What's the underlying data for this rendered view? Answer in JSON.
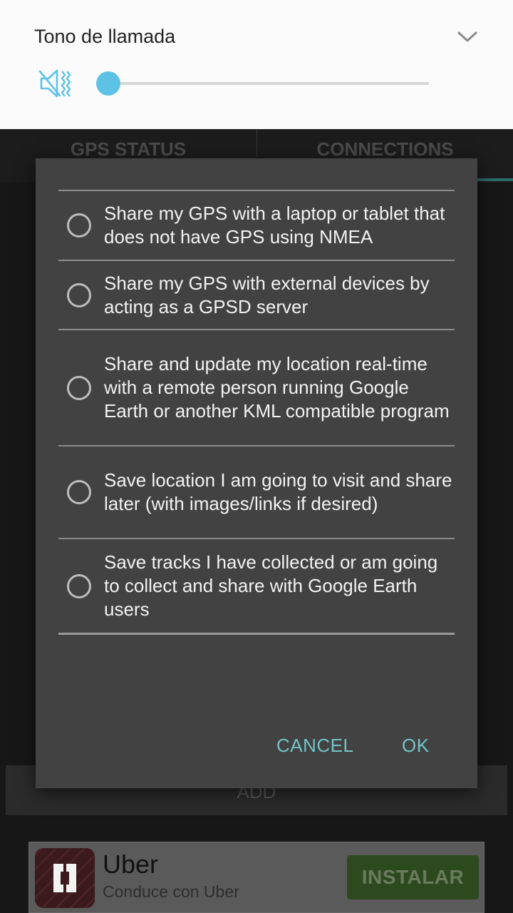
{
  "volume": {
    "title": "Tono de llamada",
    "level": 0,
    "icon": "speaker-muted-vibrate-icon",
    "accent": "#5ec2e6"
  },
  "app": {
    "tabs": [
      {
        "label": "GPS STATUS"
      },
      {
        "label": "CONNECTIONS",
        "selected": true
      }
    ],
    "add_label": "ADD"
  },
  "dialog": {
    "options": [
      {
        "text": "Share my GPS with a laptop or tablet that does not have GPS using NMEA",
        "checked": false
      },
      {
        "text": "Share my GPS with external devices by acting as a GPSD server",
        "checked": false
      },
      {
        "text": "Share and update my location real-time with a remote person running Google Earth or another KML compatible program",
        "checked": false
      },
      {
        "text": "Save location I am going to visit and share later (with images/links if desired)",
        "checked": false
      },
      {
        "text": "Save tracks I have collected or am going to collect and share with Google Earth users",
        "checked": false
      }
    ],
    "cancel_label": "CANCEL",
    "ok_label": "OK",
    "accent": "#72c3c6"
  },
  "ad": {
    "title": "Uber",
    "subtitle": "Conduce con Uber",
    "install_label": "INSTALAR",
    "logo": "uber-logo-icon"
  }
}
